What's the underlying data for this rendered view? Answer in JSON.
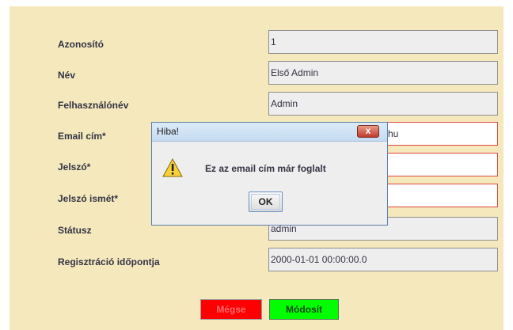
{
  "form": {
    "rows": [
      {
        "label": "Azonosító",
        "value": "1",
        "required": false
      },
      {
        "label": "Név",
        "value": "Első Admin",
        "required": false
      },
      {
        "label": "Felhasználónév",
        "value": "Admin",
        "required": false
      },
      {
        "label": "Email cím*",
        "value": "hu",
        "required": true
      },
      {
        "label": "Jelszó*",
        "value": "",
        "required": true
      },
      {
        "label": "Jelszó ismét*",
        "value": "",
        "required": true
      },
      {
        "label": "Státusz",
        "value": "admin",
        "required": false
      },
      {
        "label": "Regisztráció időpontja",
        "value": "2000-01-01 00:00:00.0",
        "required": false
      }
    ],
    "buttons": {
      "cancel": {
        "label": "Mégse",
        "color": "#ff0000"
      },
      "modify": {
        "label": "Módosít",
        "color": "#00ff00"
      }
    }
  },
  "dialog": {
    "title": "Hiba!",
    "message": "Ez az email cím már foglalt",
    "ok_label": "OK",
    "close_symbol": "x",
    "icon": "warning-icon"
  },
  "colors": {
    "panel_bg": "#f4e8bc",
    "required_border": "#e0453f"
  }
}
